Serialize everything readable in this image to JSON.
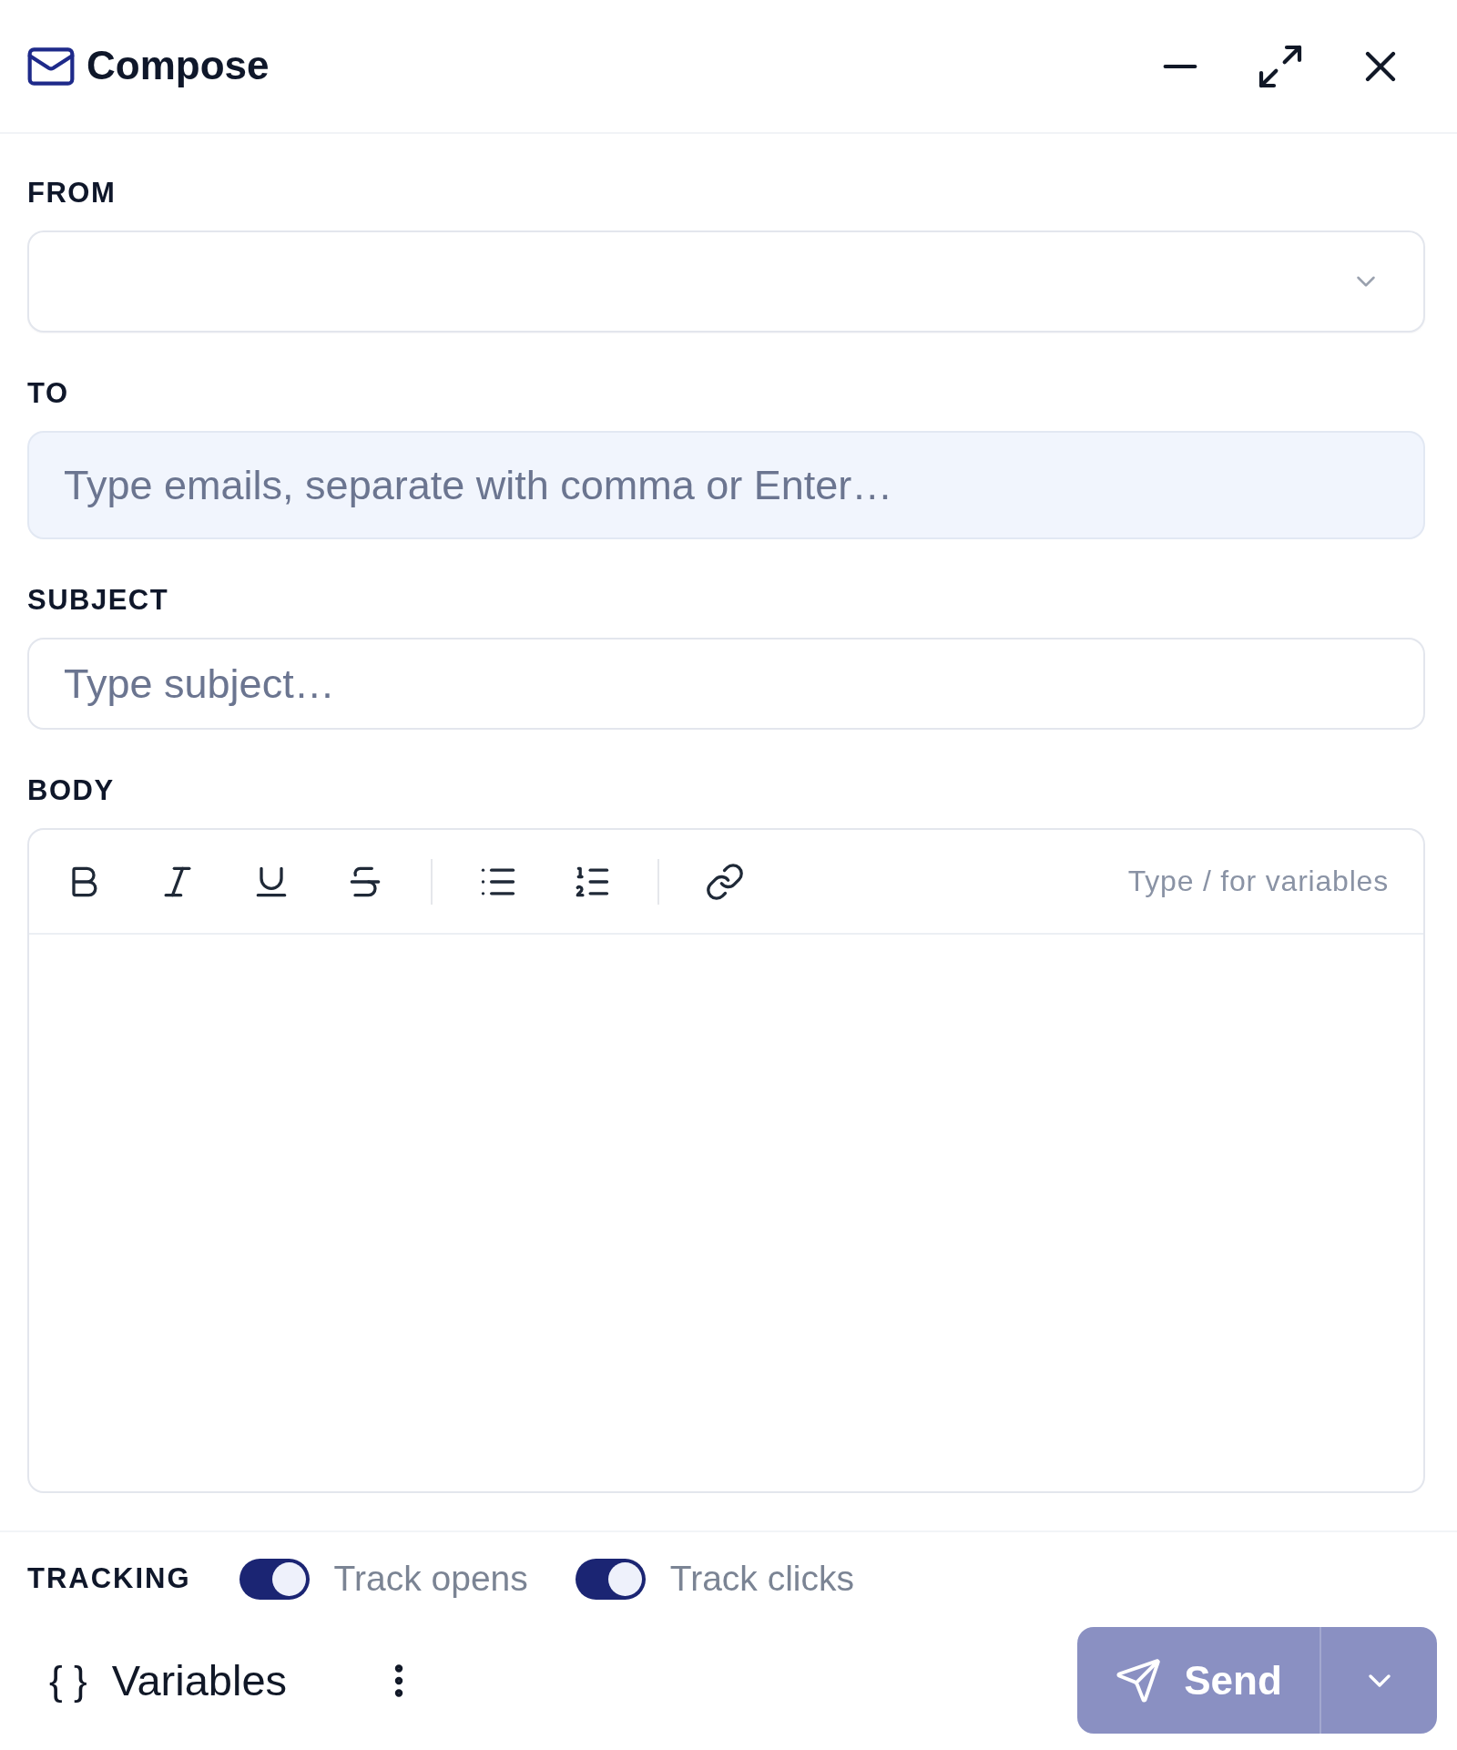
{
  "window": {
    "title": "Compose"
  },
  "fields": [
    {
      "kind": "select",
      "label": "FROM"
    },
    {
      "kind": "tags",
      "label": "TO",
      "placeholder": "Type emails, separate with comma or Enter…"
    },
    {
      "kind": "text",
      "label": "SUBJECT",
      "placeholder": "Type subject…"
    }
  ],
  "body": {
    "label": "BODY",
    "hint": "Type / for variables"
  },
  "tracking": {
    "label": "TRACKING",
    "options": [
      {
        "label": "Track opens",
        "on": true
      },
      {
        "label": "Track clicks",
        "on": true
      }
    ]
  },
  "footer": {
    "variables": {
      "glyph": "{ }",
      "label": "Variables"
    },
    "send": {
      "label": "Send",
      "disabled": true
    }
  }
}
